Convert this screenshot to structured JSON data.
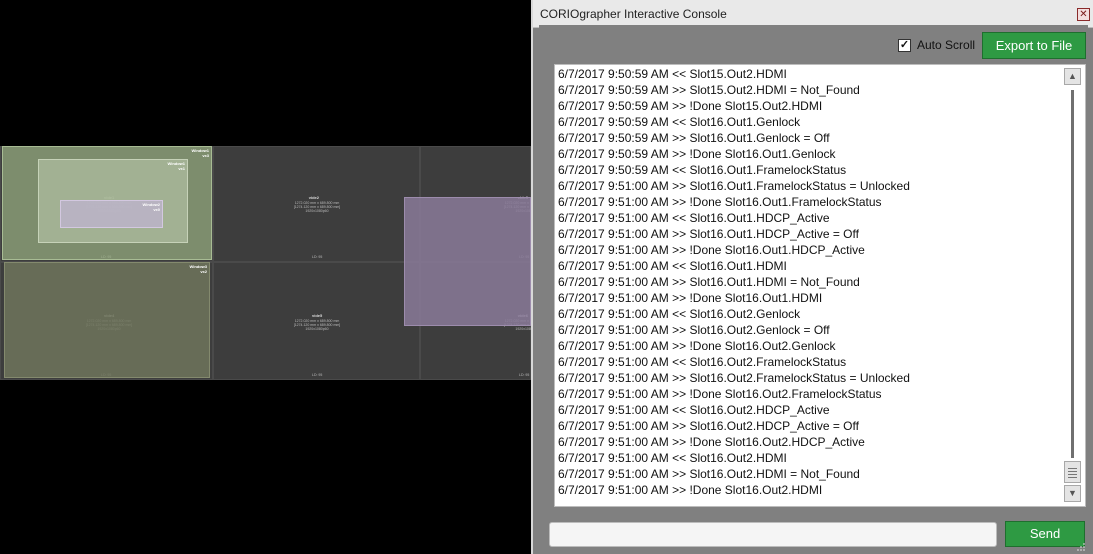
{
  "preview": {
    "displays": [
      {
        "name": "vide1",
        "info": "1272.020 mm x 689.800 mm\n[1274.120 mm x 689.800 mm]\n1920x1080p60",
        "footer": "LD: 95"
      },
      {
        "name": "vide2",
        "info": "1272.020 mm x 689.800 mm\n[1274.120 mm x 689.800 mm]\n1920x1080p60",
        "footer": "LD: 95"
      },
      {
        "name": "vide3",
        "info": "1272.020 mm x 689.800 mm\n[1274.120 mm x 689.800 mm]\n1920x1080p60",
        "footer": "LD: 95"
      },
      {
        "name": "vide4",
        "info": "1272.020 mm x 689.800 mm\n[1274.120 mm x 689.800 mm]\n1920x1080p60",
        "footer": "LD: 95"
      },
      {
        "name": "vide5",
        "info": "1272.020 mm x 689.800 mm\n[1274.120 mm x 689.800 mm]\n1920x1080p60",
        "footer": "LD: 95"
      },
      {
        "name": "vide6",
        "info": "1272.020 mm x 689.800 mm\n[1274.120 mm x 689.800 mm]\n1920x1080p60",
        "footer": "LD: 95"
      }
    ],
    "windows": [
      {
        "label": "Window1\nvx3"
      },
      {
        "label": "Window1\nvx1"
      },
      {
        "label": "Window2\nvx0"
      },
      {
        "label": "Window3\nvx2"
      }
    ]
  },
  "console": {
    "title": "CORIOgrapher Interactive Console",
    "close_glyph": "✕",
    "auto_scroll": {
      "label": "Auto Scroll",
      "checked": true,
      "check_glyph": "✓"
    },
    "export_label": "Export to File",
    "send_label": "Send",
    "input_value": "",
    "input_placeholder": "",
    "log": [
      "6/7/2017 9:50:59 AM << Slot15.Out2.HDMI",
      "6/7/2017 9:50:59 AM >> Slot15.Out2.HDMI = Not_Found",
      "6/7/2017 9:50:59 AM >> !Done Slot15.Out2.HDMI",
      "6/7/2017 9:50:59 AM << Slot16.Out1.Genlock",
      "6/7/2017 9:50:59 AM >> Slot16.Out1.Genlock = Off",
      "6/7/2017 9:50:59 AM >> !Done Slot16.Out1.Genlock",
      "6/7/2017 9:50:59 AM << Slot16.Out1.FramelockStatus",
      "6/7/2017 9:51:00 AM >> Slot16.Out1.FramelockStatus = Unlocked",
      "6/7/2017 9:51:00 AM >> !Done Slot16.Out1.FramelockStatus",
      "6/7/2017 9:51:00 AM << Slot16.Out1.HDCP_Active",
      "6/7/2017 9:51:00 AM >> Slot16.Out1.HDCP_Active = Off",
      "6/7/2017 9:51:00 AM >> !Done Slot16.Out1.HDCP_Active",
      "6/7/2017 9:51:00 AM << Slot16.Out1.HDMI",
      "6/7/2017 9:51:00 AM >> Slot16.Out1.HDMI = Not_Found",
      "6/7/2017 9:51:00 AM >> !Done Slot16.Out1.HDMI",
      "6/7/2017 9:51:00 AM << Slot16.Out2.Genlock",
      "6/7/2017 9:51:00 AM >> Slot16.Out2.Genlock = Off",
      "6/7/2017 9:51:00 AM >> !Done Slot16.Out2.Genlock",
      "6/7/2017 9:51:00 AM << Slot16.Out2.FramelockStatus",
      "6/7/2017 9:51:00 AM >> Slot16.Out2.FramelockStatus = Unlocked",
      "6/7/2017 9:51:00 AM >> !Done Slot16.Out2.FramelockStatus",
      "6/7/2017 9:51:00 AM << Slot16.Out2.HDCP_Active",
      "6/7/2017 9:51:00 AM >> Slot16.Out2.HDCP_Active = Off",
      "6/7/2017 9:51:00 AM >> !Done Slot16.Out2.HDCP_Active",
      "6/7/2017 9:51:00 AM << Slot16.Out2.HDMI",
      "6/7/2017 9:51:00 AM >> Slot16.Out2.HDMI = Not_Found",
      "6/7/2017 9:51:00 AM >> !Done Slot16.Out2.HDMI"
    ],
    "scrollbar": {
      "up_glyph": "▲",
      "down_glyph": "▼"
    }
  },
  "colors": {
    "accent_green": "#2e9a43",
    "window_green": "#8fa37a",
    "window_purple": "#8a7a99"
  }
}
